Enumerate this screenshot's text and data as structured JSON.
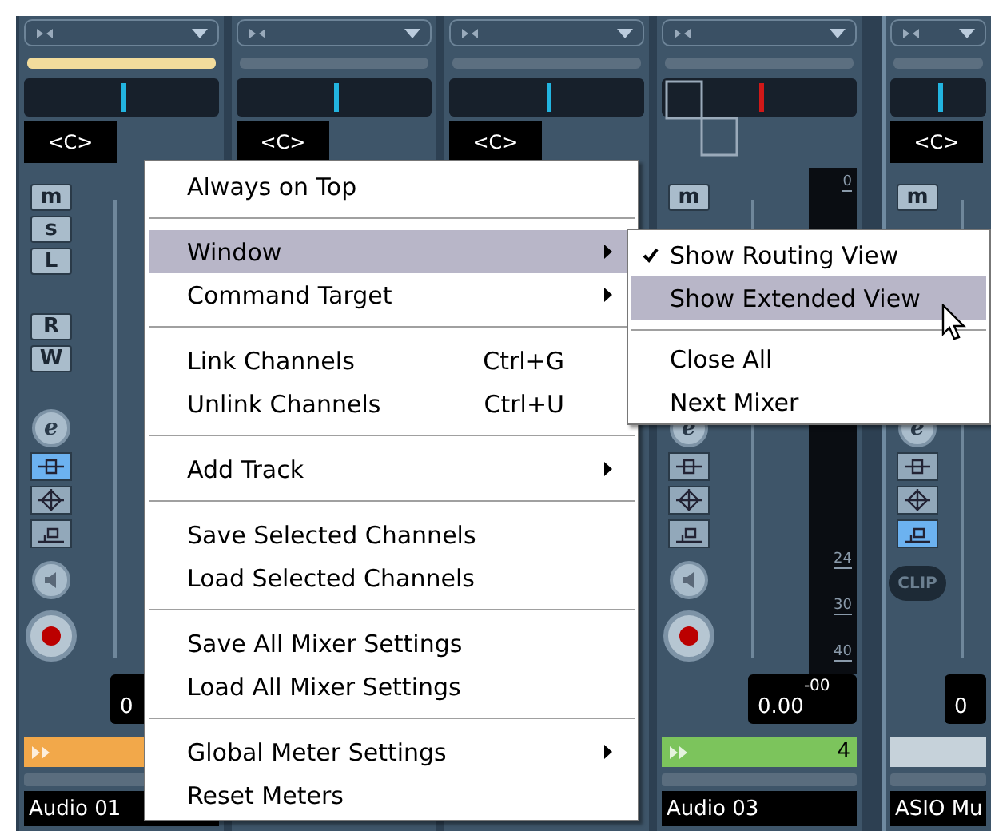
{
  "channels": [
    {
      "color": "#f2dc9c",
      "pan": {
        "kind": "pan",
        "label": "<C>"
      },
      "buttons": [
        {
          "kind": "letter",
          "label": "m"
        },
        {
          "kind": "letter",
          "label": "s"
        },
        {
          "kind": "letter",
          "label": "L"
        },
        {
          "kind": "gap"
        },
        {
          "kind": "letter",
          "label": "R"
        },
        {
          "kind": "letter",
          "label": "W"
        },
        {
          "kind": "edit",
          "label": "e"
        },
        {
          "kind": "mode",
          "selected": true
        },
        {
          "kind": "mode",
          "selected": false
        },
        {
          "kind": "mode",
          "selected": false
        },
        {
          "kind": "monitor"
        },
        {
          "kind": "record"
        }
      ],
      "value": "0",
      "track": {
        "color": "#f2a84a",
        "arrow": true
      },
      "name": "Audio 01"
    },
    {
      "color": "#5c6f80",
      "pan": {
        "kind": "pan",
        "label": "<C>"
      }
    },
    {
      "color": "#5c6f80",
      "pan": {
        "kind": "pan",
        "label": "<C>"
      }
    },
    {
      "color": "#5c6f80",
      "pan": {
        "kind": "routing"
      },
      "buttons": [
        {
          "kind": "letter",
          "label": "m"
        },
        {
          "kind": "blank"
        },
        {
          "kind": "blank"
        },
        {
          "kind": "gap"
        },
        {
          "kind": "blank"
        },
        {
          "kind": "blank"
        },
        {
          "kind": "edit",
          "label": "e"
        },
        {
          "kind": "mode",
          "selected": false
        },
        {
          "kind": "mode",
          "selected": false
        },
        {
          "kind": "mode",
          "selected": false
        },
        {
          "kind": "monitor"
        },
        {
          "kind": "record"
        }
      ],
      "meter_scale": [
        "0",
        "24",
        "30",
        "40"
      ],
      "value": "0.00",
      "peak": "-00",
      "track": {
        "color": "#7cc45c",
        "arrow": true,
        "number": "4"
      },
      "name": "Audio 03"
    },
    {
      "color": "#5c6f80",
      "pan": {
        "kind": "pan",
        "label": "<C>"
      },
      "buttons": [
        {
          "kind": "letter",
          "label": "m"
        },
        {
          "kind": "blank"
        },
        {
          "kind": "blank"
        },
        {
          "kind": "gap"
        },
        {
          "kind": "blank"
        },
        {
          "kind": "blank"
        },
        {
          "kind": "edit",
          "label": "e"
        },
        {
          "kind": "mode",
          "selected": false
        },
        {
          "kind": "mode",
          "selected": false
        },
        {
          "kind": "mode",
          "selected": true
        },
        {
          "kind": "clip",
          "label": "CLIP"
        }
      ],
      "value": "0",
      "track": {
        "color": "#c6d2da",
        "arrow": false
      },
      "name": "ASIO Mu"
    }
  ],
  "context_menu": {
    "items": [
      {
        "kind": "item",
        "label": "Always on Top",
        "selected": false
      },
      {
        "kind": "separator"
      },
      {
        "kind": "item",
        "label": "Window",
        "submenu": true,
        "selected": true
      },
      {
        "kind": "item",
        "label": "Command Target",
        "submenu": true,
        "selected": false
      },
      {
        "kind": "separator"
      },
      {
        "kind": "item",
        "label": "Link Channels",
        "shortcut": "Ctrl+G",
        "selected": false
      },
      {
        "kind": "item",
        "label": "Unlink Channels",
        "shortcut": "Ctrl+U",
        "selected": false
      },
      {
        "kind": "separator"
      },
      {
        "kind": "item",
        "label": "Add Track",
        "submenu": true,
        "selected": false
      },
      {
        "kind": "separator"
      },
      {
        "kind": "item",
        "label": "Save Selected Channels",
        "selected": false
      },
      {
        "kind": "item",
        "label": "Load Selected Channels",
        "selected": false
      },
      {
        "kind": "separator"
      },
      {
        "kind": "item",
        "label": "Save All Mixer Settings",
        "selected": false
      },
      {
        "kind": "item",
        "label": "Load All Mixer Settings",
        "selected": false
      },
      {
        "kind": "separator"
      },
      {
        "kind": "item",
        "label": "Global Meter Settings",
        "submenu": true,
        "selected": false
      },
      {
        "kind": "item",
        "label": "Reset Meters",
        "selected": false
      }
    ]
  },
  "submenu": {
    "items": [
      {
        "kind": "item",
        "label": "Show Routing View",
        "checked": true,
        "selected": false
      },
      {
        "kind": "item",
        "label": "Show Extended View",
        "checked": false,
        "selected": true
      },
      {
        "kind": "separator"
      },
      {
        "kind": "item",
        "label": "Close All",
        "checked": false,
        "selected": false
      },
      {
        "kind": "item",
        "label": "Next Mixer",
        "checked": false,
        "selected": false
      }
    ]
  }
}
